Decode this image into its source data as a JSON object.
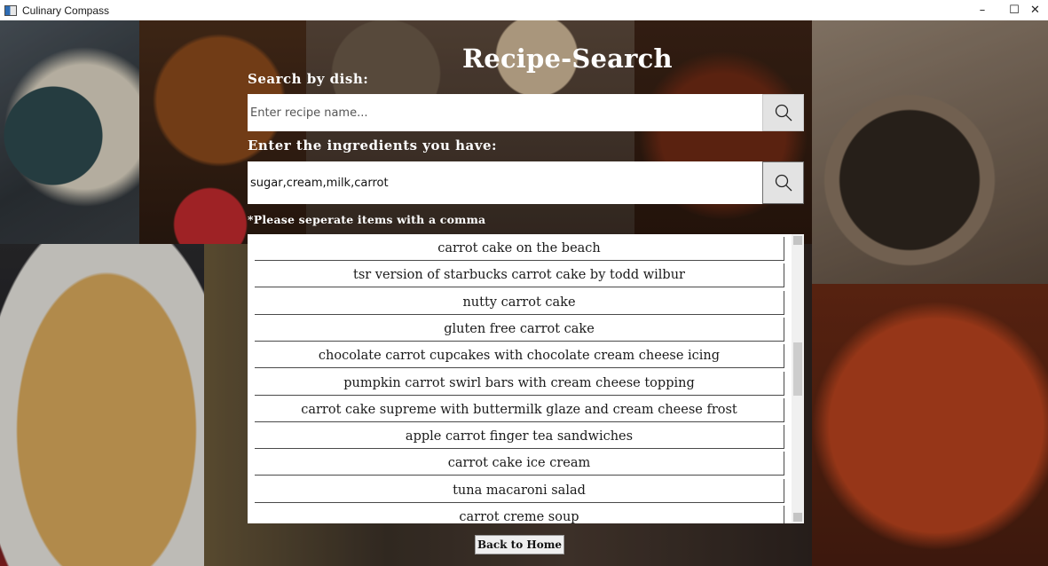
{
  "window": {
    "title": "Culinary Compass",
    "minimize": "–",
    "maximize": "☐",
    "close": "✕"
  },
  "page": {
    "title": "Recipe-Search"
  },
  "dish_search": {
    "label": "Search by dish:",
    "value": "",
    "placeholder": "Enter recipe name...",
    "button_icon": "search-icon"
  },
  "ingredient_search": {
    "label": "Enter the ingredients you have:",
    "value": "sugar,cream,milk,carrot",
    "placeholder": "",
    "button_icon": "search-icon",
    "note": "*Please seperate items with a comma"
  },
  "results": [
    "carrot cake on the beach",
    "tsr version of starbucks carrot cake by todd wilbur",
    "nutty carrot cake",
    "gluten free carrot cake",
    "chocolate carrot cupcakes with chocolate cream cheese icing",
    "pumpkin carrot swirl bars with cream cheese topping",
    "carrot cake supreme with buttermilk glaze and cream cheese frost",
    "apple carrot finger tea sandwiches",
    "carrot cake ice cream",
    "tuna macaroni salad",
    "carrot creme soup"
  ],
  "footer": {
    "back_label": "Back to Home"
  }
}
